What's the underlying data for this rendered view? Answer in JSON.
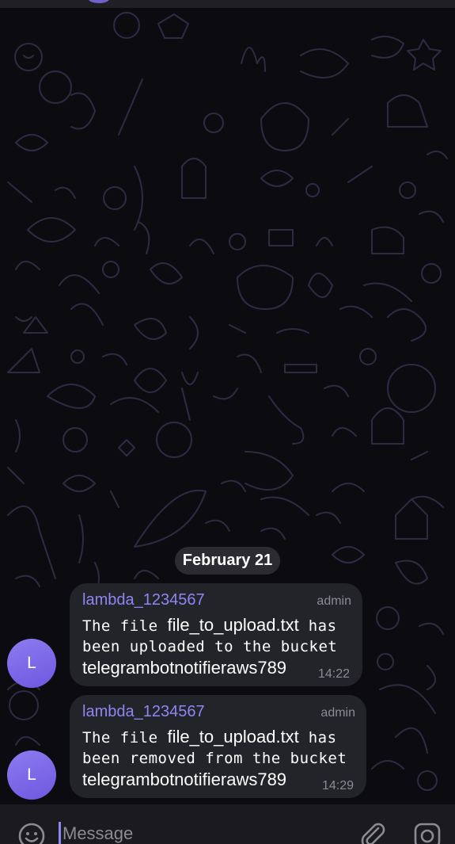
{
  "chat": {
    "date_label": "February 21",
    "messages": [
      {
        "avatar_letter": "L",
        "sender": "lambda_1234567",
        "role": "admin",
        "line1_prefix": "The file ",
        "line1_file": "file_to_upload.txt",
        "line1_suffix": " has",
        "line2": "been uploaded to the bucket",
        "line3": "telegrambotnotifieraws789",
        "time": "14:22"
      },
      {
        "avatar_letter": "L",
        "sender": "lambda_1234567",
        "role": "admin",
        "line1_prefix": "The file ",
        "line1_file": "file_to_upload.txt",
        "line1_suffix": " has",
        "line2": "been removed from the bucket",
        "line3": "telegrambotnotifieraws789",
        "time": "14:29"
      }
    ]
  },
  "composer": {
    "placeholder": "Message"
  },
  "icons": {
    "emoji": "emoji-icon",
    "attach": "paperclip-icon",
    "camera": "camera-icon"
  },
  "colors": {
    "accent": "#8f86f2",
    "bubble": "#23232a",
    "avatar": "#7b68e8"
  }
}
